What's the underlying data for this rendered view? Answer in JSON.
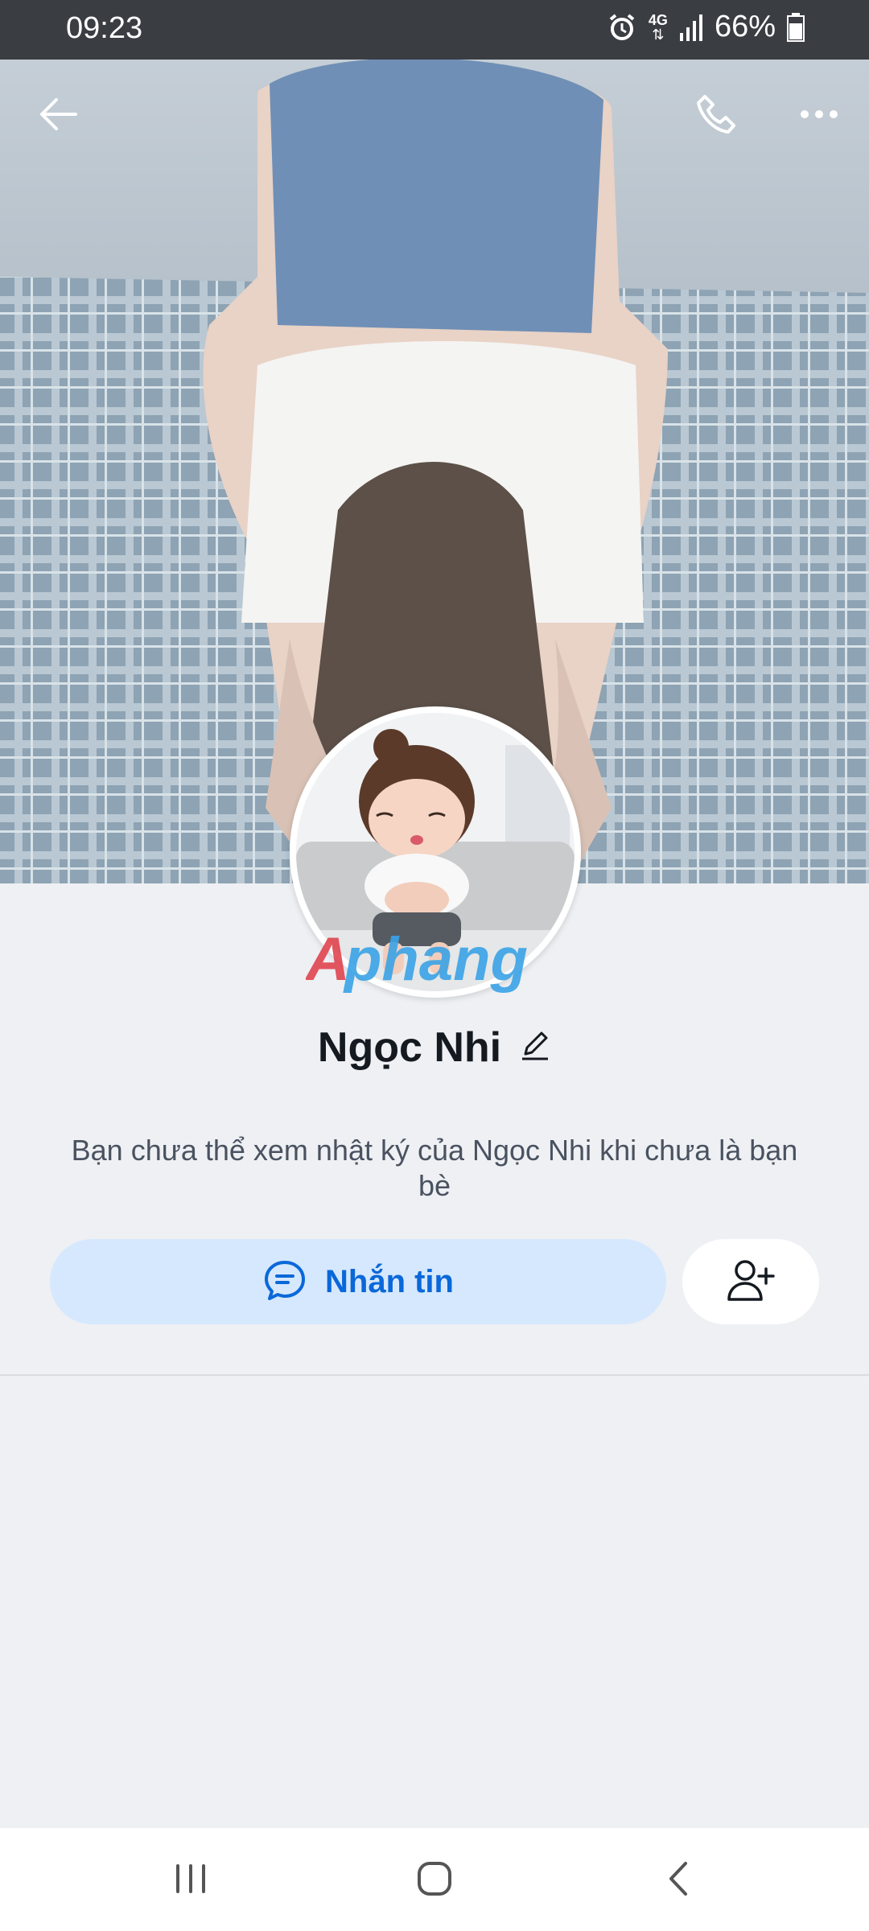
{
  "status_bar": {
    "time": "09:23",
    "network": "4G",
    "battery": "66%",
    "icons": [
      "alarm-icon",
      "network-4g-icon",
      "signal-icon",
      "battery-icon"
    ]
  },
  "header": {
    "icons": [
      "back-arrow-icon",
      "phone-icon",
      "more-icon"
    ]
  },
  "profile": {
    "name": "Ngọc Nhi",
    "watermark": "Aphang",
    "note": "Bạn chưa thể xem nhật ký của Ngọc Nhi khi chưa là bạn bè"
  },
  "actions": {
    "message_label": "Nhắn tin",
    "message_icon": "chat-bubble-icon",
    "add_friend_icon": "add-friend-icon"
  },
  "nav_bar": {
    "icons": [
      "recent-apps-icon",
      "home-icon",
      "back-icon"
    ]
  },
  "colors": {
    "accent": "#0a68d9",
    "button_bg": "#d6e8fd",
    "page_bg": "#eef0f4"
  }
}
